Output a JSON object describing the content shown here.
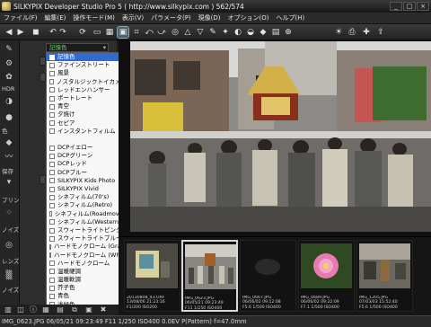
{
  "window": {
    "title": "SILKYPIX Developer Studio Pro 5 ( http://www.silkypix.com )   562/574",
    "minimize": "_",
    "maximize": "□",
    "close": "×"
  },
  "menu": [
    "ファイル(F)",
    "編集(E)",
    "操作モード(M)",
    "表示(V)",
    "パラメータ(P)",
    "現像(D)",
    "オプション(O)",
    "ヘルプ(H)"
  ],
  "toolbar": {
    "icons": [
      "back-icon",
      "forward-icon",
      "camera-icon",
      "undo-icon",
      "redo-icon",
      "refresh-icon",
      "single-view-icon",
      "grid-view-icon",
      "compare-view-icon",
      "crop-icon",
      "rotate-left-icon",
      "rotate-right-icon",
      "spot-icon",
      "highlight-warning-icon",
      "shadow-warning-icon",
      "color-pick-icon",
      "white-balance-icon",
      "gray-balance-icon",
      "tone-icon",
      "develop-icon",
      "batch-icon",
      "zoom-in-icon",
      "sun-icon",
      "print-icon",
      "plugin-icon",
      "export-icon"
    ]
  },
  "left_panel": {
    "labels": [
      "HDR",
      "色",
      "保存",
      "プリン",
      "ノイズ",
      "レンズ",
      "ノイズ"
    ],
    "selected_style": "記憶色",
    "style_options": [
      "記憶色",
      "ファインストリート",
      "風景",
      "ノスタルジックトイカメラ",
      "レッドエンハンサー",
      "ポートレート",
      "青空",
      "夕焼け",
      "セピア",
      "インスタントフィルム",
      "",
      "DCPイエロー",
      "DCPグリーン",
      "DCPレッド",
      "DCPブルー",
      "SILKYPIX Kids Photo",
      "SILKYPIX Vivid",
      "シネフィルム(70's)",
      "シネフィルム(Retro)",
      "シネフィルム(Roadmovie)",
      "シネフィルム(Western)",
      "スウィートライトピンク",
      "スウィートライトブルー",
      "ハードモノクローム (Gray T",
      "ハードモノクローム (White",
      "ハードモノクローム",
      "温暖硬調",
      "温暖軟調",
      "芥子色",
      "青色",
      "浅緑色",
      "黄色"
    ]
  },
  "filmstrip": [
    {
      "caption_1": "20130808_43.ORF",
      "caption_2": "13/08/06 21:23:16",
      "caption_3": "F1/200 ISO200"
    },
    {
      "caption_1": "IMG_0623.JPG",
      "caption_2": "06/05/21 09:23:49",
      "caption_3": "F11 1/250 ISO400"
    },
    {
      "caption_1": "IMG_0667.JPG",
      "caption_2": "06/06/02 09:12:08",
      "caption_3": "F5.6 1/500 ISO400"
    },
    {
      "caption_1": "IMG_0689.JPG",
      "caption_2": "06/06/02 09:22:09",
      "caption_3": "F7.1 1/500 ISO400"
    },
    {
      "caption_1": "IMG_1205.JPG",
      "caption_2": "07/03/03 15:52:40",
      "caption_3": "F5.6 1/500 ISO400"
    }
  ],
  "status": {
    "text": "IMG_0623.JPG 06/05/21 09:23:49 F11 1/250 ISO400   0.0EV P(Pattern) f=47.0mm"
  }
}
